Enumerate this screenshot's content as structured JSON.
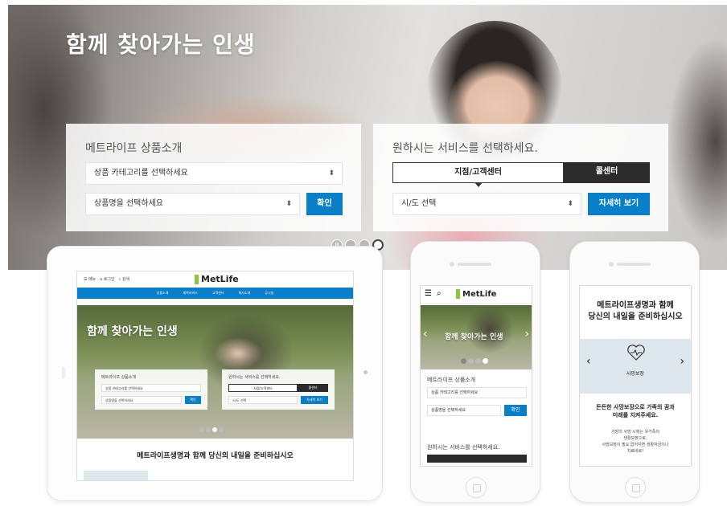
{
  "hero": {
    "title": "함께 찾아가는 인생",
    "products": {
      "title": "메트라이프 상품소개",
      "category_select": "상품 카테고리를 선택하세요",
      "product_select": "상품명을 선택하세요",
      "confirm_button": "확인"
    },
    "services": {
      "title": "원하시는 서비스를 선택하세요.",
      "tab_branch": "지점/고객센터",
      "tab_call": "콜센터",
      "region_select": "시/도 선택",
      "detail_button": "자세히 보기"
    },
    "carousel": {
      "slides": 4,
      "active_index": 3,
      "pause_icon": "pause-icon"
    }
  },
  "tablet": {
    "topbar_menu": "메뉴",
    "topbar_login": "로그인",
    "topbar_search": "검색",
    "logo": "MetLife",
    "nav": [
      "상품소개",
      "계약서비스",
      "고객센터",
      "회사소개",
      "공시실"
    ],
    "hero_title": "함께 찾아가는 인생",
    "products_title": "메트라이프 상품소개",
    "category_select": "상품 카테고리를 선택하세요",
    "product_select": "상품명을 선택하세요",
    "confirm_button": "확인",
    "services_title": "원하시는 서비스를 선택하세요.",
    "tab_branch": "지점/고객센터",
    "tab_call": "콜센터",
    "region_select": "시/도 선택",
    "detail_button": "자세히 보기",
    "footer_text": "메트라이프생명과 함께 당신의 내일을 준비하십시오"
  },
  "phone1": {
    "logo": "MetLife",
    "hero_title": "함께 찾아가는 인생",
    "products_title": "메트라이프 상품소개",
    "category_select": "상품 카테고리를 선택하세요",
    "product_select": "상품명을 선택하세요",
    "confirm_button": "확인",
    "services_title": "원하시는 서비스를 선택하세요."
  },
  "phone2": {
    "title_line1": "메트라이프생명과 함께",
    "title_line2": "당신의 내일을 준비하십시오",
    "category": "사망보장",
    "sub_line1": "든든한 사망보장으로 가족의 꿈과",
    "sub_line2": "미래를 지켜주세요.",
    "desc_line1": "가장의 사망 시에는 유가족의",
    "desc_line2": "생활보장으로,",
    "desc_line3": "사망보장이 필요 없어지면 생활자금이나",
    "desc_line4": "치료비로!"
  },
  "colors": {
    "brand_blue": "#0a7fc9",
    "dark_tab": "#2b2b2b",
    "brand_green": "#8cc63f"
  }
}
